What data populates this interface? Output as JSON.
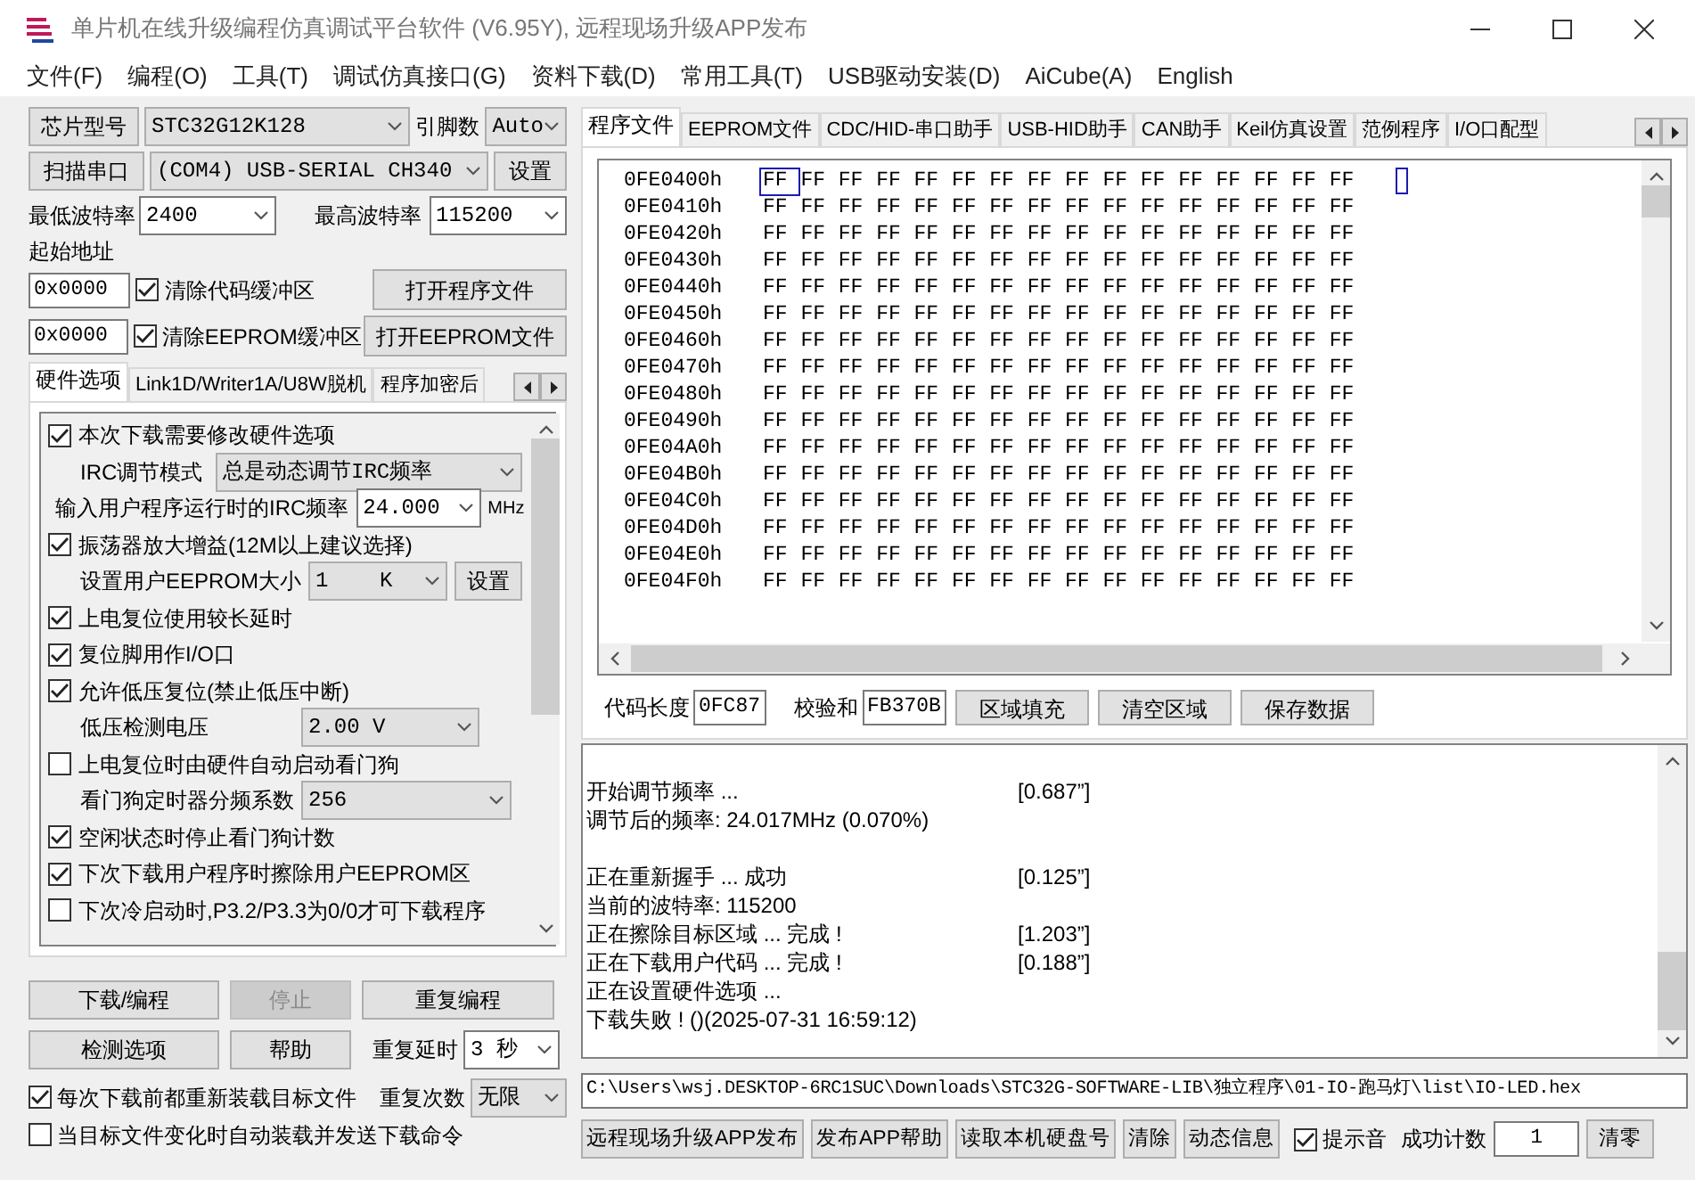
{
  "window": {
    "title": "单片机在线升级编程仿真调试平台软件 (V6.95Y), 远程现场升级APP发布"
  },
  "menu": [
    "文件(F)",
    "编程(O)",
    "工具(T)",
    "调试仿真接口(G)",
    "资料下载(D)",
    "常用工具(T)",
    "USB驱动安装(D)",
    "AiCube(A)",
    "English"
  ],
  "left": {
    "chip": {
      "button": "芯片型号",
      "value": "STC32G12K128",
      "pins_label": "引脚数",
      "pins_value": "Auto"
    },
    "port": {
      "button": "扫描串口",
      "value": "(COM4) USB-SERIAL CH340",
      "settings_button": "设置"
    },
    "baud": {
      "min_label": "最低波特率",
      "min_value": "2400",
      "max_label": "最高波特率",
      "max_value": "115200"
    },
    "start_address": {
      "label": "起始地址",
      "code_address": "0x0000",
      "clear_code": {
        "label": "清除代码缓冲区",
        "checked": true
      },
      "open_program": "打开程序文件",
      "eeprom_address": "0x0000",
      "clear_eeprom": {
        "label": "清除EEPROM缓冲区",
        "checked": true
      },
      "open_eeprom": "打开EEPROM文件"
    },
    "tabs": [
      {
        "label": "硬件选项",
        "selected": true
      },
      {
        "label": "Link1D/Writer1A/U8W脱机",
        "selected": false
      },
      {
        "label": "程序加密后",
        "selected": false
      }
    ],
    "options": [
      {
        "kind": "check",
        "label": "本次下载需要修改硬件选项",
        "checked": true
      },
      {
        "kind": "select",
        "label": "IRC调节模式",
        "value": "总是动态调节IRC频率"
      },
      {
        "kind": "input_select",
        "label": "输入用户程序运行时的IRC频率",
        "value": "24.000",
        "unit": "MHz"
      },
      {
        "kind": "check",
        "label": "振荡器放大增益(12M以上建议选择)",
        "checked": true
      },
      {
        "kind": "select_button",
        "label": "设置用户EEPROM大小",
        "value": "1    K",
        "button": "设置"
      },
      {
        "kind": "check",
        "label": "上电复位使用较长延时",
        "checked": true
      },
      {
        "kind": "check",
        "label": "复位脚用作I/O口",
        "checked": true
      },
      {
        "kind": "check",
        "label": "允许低压复位(禁止低压中断)",
        "checked": true
      },
      {
        "kind": "select",
        "label": "低压检测电压",
        "value": "2.00 V"
      },
      {
        "kind": "check",
        "label": "上电复位时由硬件自动启动看门狗",
        "checked": false
      },
      {
        "kind": "select",
        "label": "看门狗定时器分频系数",
        "value": "256"
      },
      {
        "kind": "check",
        "label": "空闲状态时停止看门狗计数",
        "checked": true
      },
      {
        "kind": "check",
        "label": "下次下载用户程序时擦除用户EEPROM区",
        "checked": true
      },
      {
        "kind": "check",
        "label": "下次冷启动时,P3.2/P3.3为0/0才可下载程序",
        "checked": false
      }
    ],
    "buttons": [
      {
        "label": "下载/编程",
        "disabled": false
      },
      {
        "label": "停止",
        "disabled": true
      },
      {
        "label": "重复编程",
        "disabled": false
      },
      {
        "label": "检测选项",
        "disabled": false
      },
      {
        "label": "帮助",
        "disabled": false
      }
    ],
    "repeat_delay": {
      "label": "重复延时",
      "value": "3 秒"
    },
    "repeat_count": {
      "label": "重复次数",
      "value": "无限"
    },
    "reload_checks": [
      {
        "label": "每次下载前都重新装载目标文件",
        "checked": true
      },
      {
        "label": "当目标文件变化时自动装载并发送下载命令",
        "checked": false
      }
    ]
  },
  "right": {
    "tabs": [
      {
        "label": "程序文件",
        "selected": true
      },
      {
        "label": "EEPROM文件",
        "selected": false
      },
      {
        "label": "CDC/HID-串口助手",
        "selected": false
      },
      {
        "label": "USB-HID助手",
        "selected": false
      },
      {
        "label": "CAN助手",
        "selected": false
      },
      {
        "label": "Keil仿真设置",
        "selected": false
      },
      {
        "label": "范例程序",
        "selected": false
      },
      {
        "label": "I/O口配型",
        "selected": false
      }
    ],
    "hex_rows": [
      {
        "address": "0FE0400h",
        "cursor": true,
        "bytes": [
          "FF",
          "FF",
          "FF",
          "FF",
          "FF",
          "FF",
          "FF",
          "FF",
          "FF",
          "FF",
          "FF",
          "FF",
          "FF",
          "FF",
          "FF",
          "FF"
        ]
      },
      {
        "address": "0FE0410h",
        "cursor": false,
        "bytes": [
          "FF",
          "FF",
          "FF",
          "FF",
          "FF",
          "FF",
          "FF",
          "FF",
          "FF",
          "FF",
          "FF",
          "FF",
          "FF",
          "FF",
          "FF",
          "FF"
        ]
      },
      {
        "address": "0FE0420h",
        "cursor": false,
        "bytes": [
          "FF",
          "FF",
          "FF",
          "FF",
          "FF",
          "FF",
          "FF",
          "FF",
          "FF",
          "FF",
          "FF",
          "FF",
          "FF",
          "FF",
          "FF",
          "FF"
        ]
      },
      {
        "address": "0FE0430h",
        "cursor": false,
        "bytes": [
          "FF",
          "FF",
          "FF",
          "FF",
          "FF",
          "FF",
          "FF",
          "FF",
          "FF",
          "FF",
          "FF",
          "FF",
          "FF",
          "FF",
          "FF",
          "FF"
        ]
      },
      {
        "address": "0FE0440h",
        "cursor": false,
        "bytes": [
          "FF",
          "FF",
          "FF",
          "FF",
          "FF",
          "FF",
          "FF",
          "FF",
          "FF",
          "FF",
          "FF",
          "FF",
          "FF",
          "FF",
          "FF",
          "FF"
        ]
      },
      {
        "address": "0FE0450h",
        "cursor": false,
        "bytes": [
          "FF",
          "FF",
          "FF",
          "FF",
          "FF",
          "FF",
          "FF",
          "FF",
          "FF",
          "FF",
          "FF",
          "FF",
          "FF",
          "FF",
          "FF",
          "FF"
        ]
      },
      {
        "address": "0FE0460h",
        "cursor": false,
        "bytes": [
          "FF",
          "FF",
          "FF",
          "FF",
          "FF",
          "FF",
          "FF",
          "FF",
          "FF",
          "FF",
          "FF",
          "FF",
          "FF",
          "FF",
          "FF",
          "FF"
        ]
      },
      {
        "address": "0FE0470h",
        "cursor": false,
        "bytes": [
          "FF",
          "FF",
          "FF",
          "FF",
          "FF",
          "FF",
          "FF",
          "FF",
          "FF",
          "FF",
          "FF",
          "FF",
          "FF",
          "FF",
          "FF",
          "FF"
        ]
      },
      {
        "address": "0FE0480h",
        "cursor": false,
        "bytes": [
          "FF",
          "FF",
          "FF",
          "FF",
          "FF",
          "FF",
          "FF",
          "FF",
          "FF",
          "FF",
          "FF",
          "FF",
          "FF",
          "FF",
          "FF",
          "FF"
        ]
      },
      {
        "address": "0FE0490h",
        "cursor": false,
        "bytes": [
          "FF",
          "FF",
          "FF",
          "FF",
          "FF",
          "FF",
          "FF",
          "FF",
          "FF",
          "FF",
          "FF",
          "FF",
          "FF",
          "FF",
          "FF",
          "FF"
        ]
      },
      {
        "address": "0FE04A0h",
        "cursor": false,
        "bytes": [
          "FF",
          "FF",
          "FF",
          "FF",
          "FF",
          "FF",
          "FF",
          "FF",
          "FF",
          "FF",
          "FF",
          "FF",
          "FF",
          "FF",
          "FF",
          "FF"
        ]
      },
      {
        "address": "0FE04B0h",
        "cursor": false,
        "bytes": [
          "FF",
          "FF",
          "FF",
          "FF",
          "FF",
          "FF",
          "FF",
          "FF",
          "FF",
          "FF",
          "FF",
          "FF",
          "FF",
          "FF",
          "FF",
          "FF"
        ]
      },
      {
        "address": "0FE04C0h",
        "cursor": false,
        "bytes": [
          "FF",
          "FF",
          "FF",
          "FF",
          "FF",
          "FF",
          "FF",
          "FF",
          "FF",
          "FF",
          "FF",
          "FF",
          "FF",
          "FF",
          "FF",
          "FF"
        ]
      },
      {
        "address": "0FE04D0h",
        "cursor": false,
        "bytes": [
          "FF",
          "FF",
          "FF",
          "FF",
          "FF",
          "FF",
          "FF",
          "FF",
          "FF",
          "FF",
          "FF",
          "FF",
          "FF",
          "FF",
          "FF",
          "FF"
        ]
      },
      {
        "address": "0FE04E0h",
        "cursor": false,
        "bytes": [
          "FF",
          "FF",
          "FF",
          "FF",
          "FF",
          "FF",
          "FF",
          "FF",
          "FF",
          "FF",
          "FF",
          "FF",
          "FF",
          "FF",
          "FF",
          "FF"
        ]
      },
      {
        "address": "0FE04F0h",
        "cursor": false,
        "bytes": [
          "FF",
          "FF",
          "FF",
          "FF",
          "FF",
          "FF",
          "FF",
          "FF",
          "FF",
          "FF",
          "FF",
          "FF",
          "FF",
          "FF",
          "FF",
          "FF"
        ]
      }
    ],
    "code_length": {
      "label": "代码长度",
      "value": "0FC87"
    },
    "checksum": {
      "label": "校验和",
      "value": "FB370B"
    },
    "hex_buttons": [
      "区域填充",
      "清空区域",
      "保存数据"
    ],
    "log": [
      {
        "kind": "line",
        "text": "开始调节频率 ...",
        "time": "[0.687”]"
      },
      {
        "kind": "line",
        "text": "调节后的频率: 24.017MHz (0.070%)"
      },
      {
        "kind": "blank"
      },
      {
        "kind": "line",
        "text": "正在重新握手 ... 成功",
        "time": "[0.125”]"
      },
      {
        "kind": "line",
        "text": "当前的波特率: 115200"
      },
      {
        "kind": "line",
        "text": "正在擦除目标区域 ... 完成 !",
        "time": "[1.203”]"
      },
      {
        "kind": "line",
        "text": "正在下载用户代码 ... 完成 !",
        "time": "[0.188”]"
      },
      {
        "kind": "line",
        "text": "正在设置硬件选项 ..."
      },
      {
        "kind": "line",
        "text": "下载失败 ! ()(2025-07-31 16:59:12)"
      }
    ],
    "file_path": "C:\\Users\\wsj.DESKTOP-6RC1SUC\\Downloads\\STC32G-SOFTWARE-LIB\\独立程序\\01-IO-跑马灯\\list\\IO-LED.hex",
    "bottom_buttons": [
      "远程现场升级APP发布",
      "发布APP帮助",
      "读取本机硬盘号",
      "清除",
      "动态信息"
    ],
    "beep": {
      "label": "提示音",
      "checked": true
    },
    "success_count": {
      "label": "成功计数",
      "value": "1"
    },
    "reset_button": "清零"
  }
}
